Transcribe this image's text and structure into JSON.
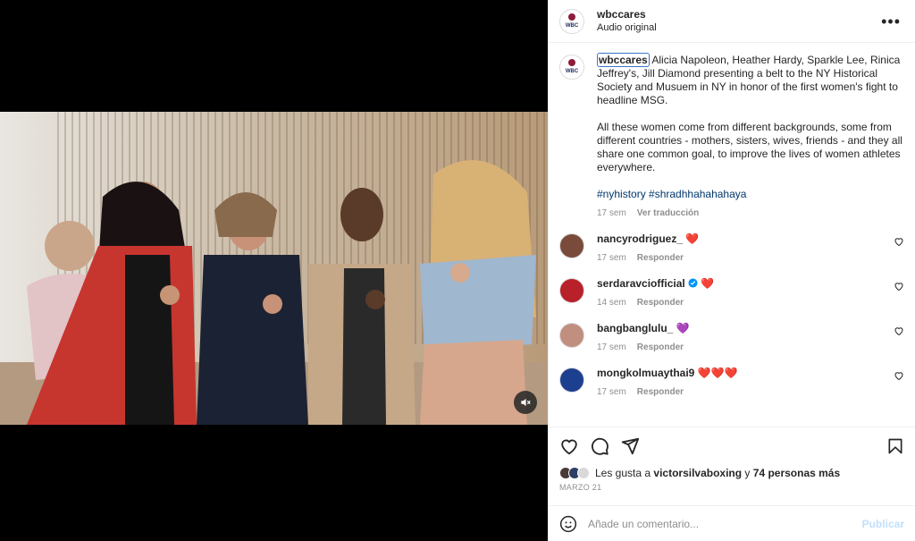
{
  "media": {
    "mute_icon": "speaker-muted-icon"
  },
  "header": {
    "username": "wbccares",
    "subtext": "Audio original",
    "more_icon": "more-horizontal-icon",
    "avatar_text": "WBC"
  },
  "caption": {
    "username": "wbccares",
    "text": "Alicia Napoleon, Heather Hardy, Sparkle Lee, Rinica Jeffrey's, Jill Diamond presenting a belt to the NY Historical Society and Musuem in NY in honor of the first women's fight to headline MSG.",
    "text2": "All these women come from different backgrounds, some from different countries - mothers, sisters, wives, friends - and they all share one common goal, to improve the lives of women athletes everywhere.",
    "hashtags": "#nyhistory #shradhhahahahaya",
    "time": "17 sem",
    "translate": "Ver traducción"
  },
  "comments": [
    {
      "username": "nancyrodriguez_",
      "text": "❤️",
      "time": "17 sem",
      "reply": "Responder",
      "verified": false
    },
    {
      "username": "serdaravciofficial",
      "text": "❤️",
      "time": "14 sem",
      "reply": "Responder",
      "verified": true
    },
    {
      "username": "bangbanglulu_",
      "text": "💜",
      "time": "17 sem",
      "reply": "Responder",
      "verified": false
    },
    {
      "username": "mongkolmuaythai9",
      "text": "❤️❤️❤️",
      "time": "17 sem",
      "reply": "Responder",
      "verified": false
    }
  ],
  "actions": {
    "like_icon": "heart-icon",
    "comment_icon": "comment-icon",
    "share_icon": "send-icon",
    "save_icon": "bookmark-icon"
  },
  "likes": {
    "prefix": "Les gusta a ",
    "user": "victorsilvaboxing",
    "mid": " y ",
    "others": "74 personas más"
  },
  "date": "MARZO 21",
  "comment_input": {
    "placeholder": "Añade un comentario...",
    "post_label": "Publicar",
    "emoji_icon": "emoji-icon"
  },
  "colors": {
    "link": "#00376b",
    "muted": "#8e8e8e",
    "verified": "#0095f6",
    "post_disabled": "#c0dffd",
    "heart": "#ed4956"
  }
}
